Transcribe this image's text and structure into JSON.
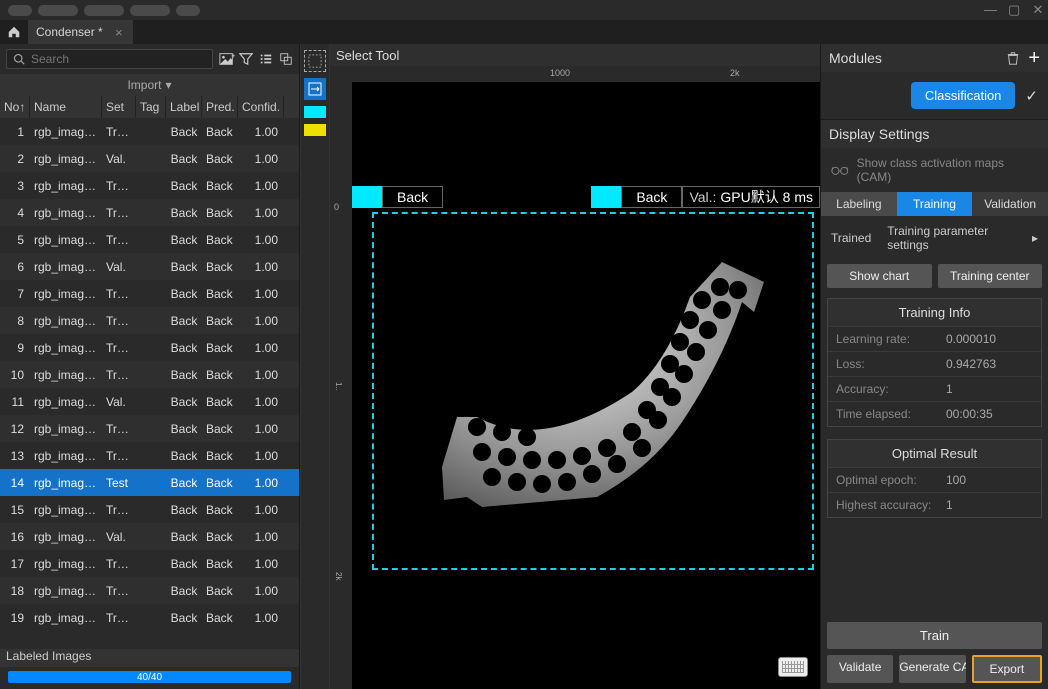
{
  "window": {
    "tab_title": "Condenser *"
  },
  "left_panel": {
    "search_placeholder": "Search",
    "import_label": "Import",
    "columns": {
      "no": "No↑",
      "name": "Name",
      "set": "Set",
      "tag": "Tag",
      "label": "Label",
      "pred": "Pred.",
      "conf": "Confid."
    },
    "rows": [
      {
        "no": "1",
        "name": "rgb_image...",
        "set": "Train",
        "label": "Back",
        "pred": "Back",
        "conf": "1.00"
      },
      {
        "no": "2",
        "name": "rgb_image...",
        "set": "Val.",
        "label": "Back",
        "pred": "Back",
        "conf": "1.00"
      },
      {
        "no": "3",
        "name": "rgb_image...",
        "set": "Train",
        "label": "Back",
        "pred": "Back",
        "conf": "1.00"
      },
      {
        "no": "4",
        "name": "rgb_image...",
        "set": "Train",
        "label": "Back",
        "pred": "Back",
        "conf": "1.00"
      },
      {
        "no": "5",
        "name": "rgb_image...",
        "set": "Train",
        "label": "Back",
        "pred": "Back",
        "conf": "1.00"
      },
      {
        "no": "6",
        "name": "rgb_image...",
        "set": "Val.",
        "label": "Back",
        "pred": "Back",
        "conf": "1.00"
      },
      {
        "no": "7",
        "name": "rgb_image...",
        "set": "Train",
        "label": "Back",
        "pred": "Back",
        "conf": "1.00"
      },
      {
        "no": "8",
        "name": "rgb_image...",
        "set": "Train",
        "label": "Back",
        "pred": "Back",
        "conf": "1.00"
      },
      {
        "no": "9",
        "name": "rgb_image...",
        "set": "Train",
        "label": "Back",
        "pred": "Back",
        "conf": "1.00"
      },
      {
        "no": "10",
        "name": "rgb_image...",
        "set": "Train",
        "label": "Back",
        "pred": "Back",
        "conf": "1.00"
      },
      {
        "no": "11",
        "name": "rgb_image...",
        "set": "Val.",
        "label": "Back",
        "pred": "Back",
        "conf": "1.00"
      },
      {
        "no": "12",
        "name": "rgb_image...",
        "set": "Train",
        "label": "Back",
        "pred": "Back",
        "conf": "1.00"
      },
      {
        "no": "13",
        "name": "rgb_image...",
        "set": "Train",
        "label": "Back",
        "pred": "Back",
        "conf": "1.00"
      },
      {
        "no": "14",
        "name": "rgb_image...",
        "set": "Test",
        "label": "Back",
        "pred": "Back",
        "conf": "1.00",
        "selected": true
      },
      {
        "no": "15",
        "name": "rgb_image...",
        "set": "Train",
        "label": "Back",
        "pred": "Back",
        "conf": "1.00"
      },
      {
        "no": "16",
        "name": "rgb_image...",
        "set": "Val.",
        "label": "Back",
        "pred": "Back",
        "conf": "1.00"
      },
      {
        "no": "17",
        "name": "rgb_image...",
        "set": "Train",
        "label": "Back",
        "pred": "Back",
        "conf": "1.00"
      },
      {
        "no": "18",
        "name": "rgb_image...",
        "set": "Train",
        "label": "Back",
        "pred": "Back",
        "conf": "1.00"
      },
      {
        "no": "19",
        "name": "rgb_image...",
        "set": "Train",
        "label": "Back",
        "pred": "Back",
        "conf": "1.00"
      }
    ],
    "footer_label": "Labeled Images",
    "progress_text": "40/40"
  },
  "center": {
    "title": "Select Tool",
    "ruler_ticks": [
      "1000",
      "2k"
    ],
    "overlay": {
      "label_left": "Back",
      "label_right": "Back",
      "val_prefix": "Val.:",
      "val_text": "GPU默认 8 ms"
    }
  },
  "right": {
    "modules_title": "Modules",
    "classification_label": "Classification",
    "display_settings_title": "Display Settings",
    "cam_label": "Show class activation maps (CAM)",
    "tabs": {
      "labeling": "Labeling",
      "training": "Training",
      "validation": "Validation"
    },
    "trained_label": "Trained",
    "param_link": "Training parameter settings",
    "show_chart_btn": "Show chart",
    "training_center_btn": "Training center",
    "training_info": {
      "title": "Training Info",
      "learning_rate_k": "Learning rate:",
      "learning_rate_v": "0.000010",
      "loss_k": "Loss:",
      "loss_v": "0.942763",
      "accuracy_k": "Accuracy:",
      "accuracy_v": "1",
      "time_k": "Time elapsed:",
      "time_v": "00:00:35"
    },
    "optimal": {
      "title": "Optimal Result",
      "epoch_k": "Optimal epoch:",
      "epoch_v": "100",
      "acc_k": "Highest accuracy:",
      "acc_v": "1"
    },
    "footer": {
      "train": "Train",
      "validate": "Validate",
      "generate_cam": "Generate CAM",
      "export": "Export"
    }
  }
}
